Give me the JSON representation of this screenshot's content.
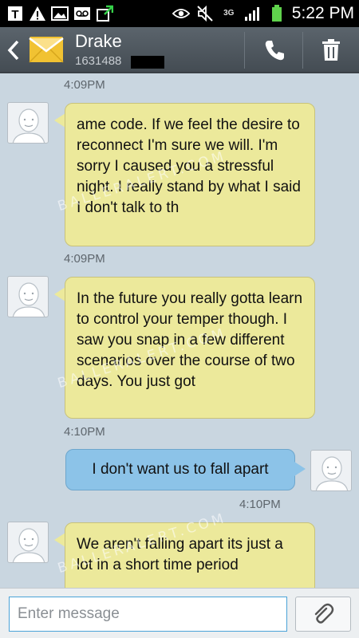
{
  "status_bar": {
    "time": "5:22 PM",
    "network": "3G",
    "icons": [
      "t-mobile-icon",
      "warning-icon",
      "gallery-icon",
      "voicemail-icon",
      "upload-icon",
      "eye-icon",
      "mute-icon",
      "signal-icon",
      "battery-icon"
    ]
  },
  "header": {
    "contact_name": "Drake",
    "contact_number": "1631488",
    "icons": [
      "back-icon",
      "envelope-icon",
      "phone-icon",
      "trash-icon"
    ]
  },
  "watermark": "BALLERALERT.COM",
  "messages": [
    {
      "direction": "in",
      "time": "4:09PM",
      "text": "ame code. If we feel the desire to reconnect I'm sure we will. I'm sorry I caused you a stressful night. I really stand by what I said I don't talk to th"
    },
    {
      "direction": "in",
      "time": "4:09PM",
      "text": "In the future you really gotta learn to control your temper though. I saw you snap in a few different scenarios over the course of two days. You just got"
    },
    {
      "direction": "in",
      "time": "4:10PM",
      "text": ""
    },
    {
      "direction": "out",
      "time": "",
      "text": "I don't want us to fall apart"
    },
    {
      "direction": "out",
      "time": "4:10PM",
      "text": ""
    },
    {
      "direction": "in",
      "time": "",
      "text": "We aren't falling apart its just a lot in a short time period"
    }
  ],
  "timestamps": [
    "4:09PM",
    "4:09PM",
    "4:10PM",
    "4:10PM"
  ],
  "composer": {
    "placeholder": "Enter message",
    "value": ""
  },
  "colors": {
    "incoming_bubble": "#ece99b",
    "outgoing_bubble": "#8cc3e8",
    "background": "#c9d6e0",
    "header": "#4f575e"
  }
}
